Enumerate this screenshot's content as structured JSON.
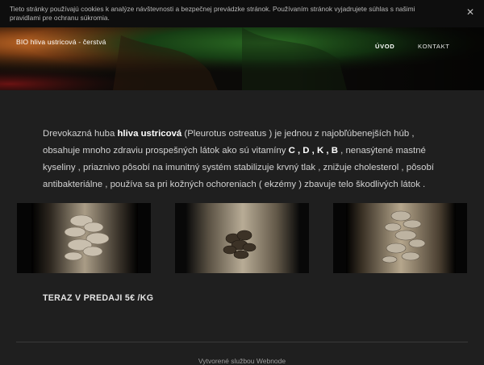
{
  "cookie": {
    "text": "Tieto stránky používajú cookies k analýze návštevnosti a bezpečnej prevádzke stránok. Používaním stránok vyjadrujete súhlas s našimi pravidlami pre ochranu súkromia.",
    "close_label": "✕"
  },
  "header": {
    "site_title": "BIO hliva ustricová - čerstvá",
    "nav": [
      {
        "label": "ÚVOD"
      },
      {
        "label": "KONTAKT"
      }
    ]
  },
  "intro": {
    "part1": "Drevokazná huba ",
    "bold1": "hliva ustricová",
    "part2": " (Pleurotus ostreatus ) je jednou z najobľúbenejších húb , obsahuje mnoho zdraviu prospešných látok ako sú vitamíny ",
    "bold2": "C , D , K , B",
    "part3": " , nenasýtené mastné kyseliny , priaznivo pôsobí na imunitný systém stabilizuje krvný tlak , znižuje cholesterol , pôsobí antibakteriálne , používa sa pri kožných ochoreniach ( ekzémy ) zbavuje telo škodlivých látok ."
  },
  "sale": {
    "label": "TERAZ V PREDAJI 5€ /KG"
  },
  "footer": {
    "text": "Vytvorené službou Webnode"
  },
  "colors": {
    "background": "#1f1f1f",
    "cookie_bar": "#0e0e0e",
    "hero_green": "#1d4a18",
    "hero_orange": "#c2631c"
  }
}
